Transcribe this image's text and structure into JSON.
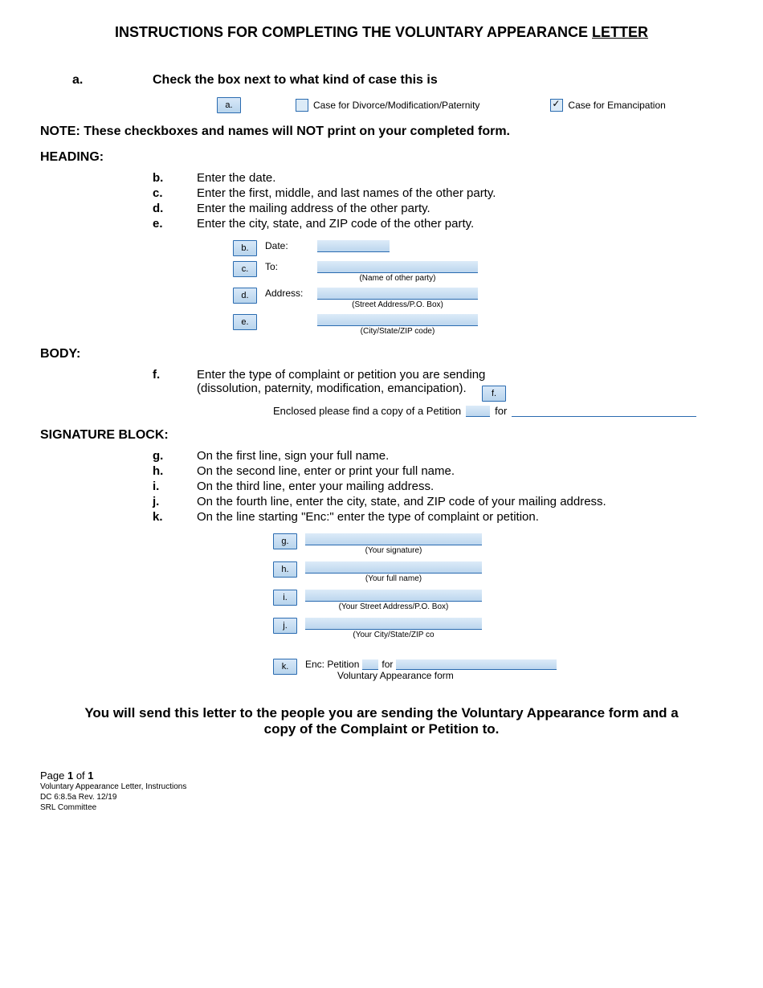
{
  "title_prefix": "INSTRUCTIONS FOR COMPLETING THE VOLUNTARY APPEARANCE ",
  "title_suffix": "LETTER",
  "a": {
    "label": "a.",
    "text": "Check the box next to what kind of case this is"
  },
  "fig_a": {
    "tag": "a.",
    "opt1": "Case for Divorce/Modification/Paternity",
    "opt2": "Case for Emancipation"
  },
  "note": "NOTE: These checkboxes and names will NOT print on your completed form.",
  "heading": "HEADING:",
  "b": {
    "label": "b.",
    "text": "Enter the date."
  },
  "c": {
    "label": "c.",
    "text": "Enter the first, middle, and last names of the other party."
  },
  "d": {
    "label": "d.",
    "text": "Enter the mailing address of the other party."
  },
  "e": {
    "label": "e.",
    "text": "Enter the city, state, and ZIP code of the other party."
  },
  "fig_be": {
    "b": {
      "tag": "b.",
      "label": "Date:"
    },
    "c": {
      "tag": "c.",
      "label": "To:",
      "sub": "(Name of other party)"
    },
    "d": {
      "tag": "d.",
      "label": "Address:",
      "sub": "(Street Address/P.O. Box)"
    },
    "e": {
      "tag": "e.",
      "sub": "(City/State/ZIP code)"
    }
  },
  "body": "BODY:",
  "f": {
    "label": "f.",
    "text": "Enter the type of complaint or petition you are sending (dissolution, paternity, modification, emancipation)."
  },
  "fig_f": {
    "tag": "f.",
    "text1": "Enclosed please find a copy of a Petition",
    "text2": "for"
  },
  "sig": "SIGNATURE BLOCK:",
  "g": {
    "label": "g.",
    "text": "On the first line, sign your full name."
  },
  "h": {
    "label": "h.",
    "text": "On the second line, enter or print your full name."
  },
  "i": {
    "label": "i.",
    "text": "On the third line, enter your mailing address."
  },
  "j": {
    "label": "j.",
    "text": "On the fourth line, enter the city, state, and ZIP code of your mailing address."
  },
  "k": {
    "label": "k.",
    "text": "On the line starting \"Enc:\" enter the type of complaint or petition."
  },
  "fig_gk": {
    "g": {
      "tag": "g.",
      "sub": "(Your signature)"
    },
    "h": {
      "tag": "h.",
      "sub": "(Your full name)"
    },
    "i": {
      "tag": "i.",
      "sub": "(Your Street Address/P.O. Box)"
    },
    "j": {
      "tag": "j.",
      "sub": "(Your City/State/ZIP co"
    },
    "k": {
      "tag": "k.",
      "enc": "Enc: Petition",
      "for": "for",
      "sub": "Voluntary Appearance form"
    }
  },
  "footer_msg": "You will send this letter to the people you are sending the Voluntary Appearance form and a copy of the Complaint or Petition to.",
  "footer": {
    "page_a": "Page ",
    "page_b": "1",
    "page_c": " of ",
    "page_d": "1",
    "l2": "Voluntary Appearance Letter, Instructions",
    "l3": "DC 6:8.5a Rev. 12/19",
    "l4": "SRL Committee"
  }
}
